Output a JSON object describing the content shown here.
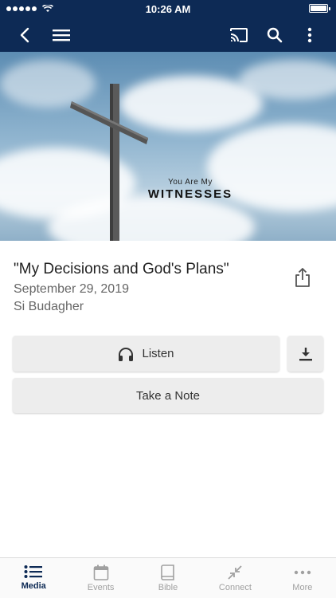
{
  "status_bar": {
    "time": "10:26 AM"
  },
  "hero": {
    "small_text": "You Are My",
    "big_text": "WITNESSES"
  },
  "sermon": {
    "title": "\"My Decisions and God's Plans\"",
    "date": "September 29, 2019",
    "speaker": "Si Budagher"
  },
  "actions": {
    "listen_label": "Listen",
    "note_label": "Take a Note"
  },
  "tabs": [
    {
      "label": "Media",
      "icon": "list-icon",
      "active": true
    },
    {
      "label": "Events",
      "icon": "calendar-icon"
    },
    {
      "label": "Bible",
      "icon": "book-icon"
    },
    {
      "label": "Connect",
      "icon": "connect-icon"
    },
    {
      "label": "More",
      "icon": "more-icon"
    }
  ],
  "colors": {
    "brand": "#0d2a55",
    "button_bg": "#ededed",
    "inactive_tab": "#a0a0a0"
  }
}
